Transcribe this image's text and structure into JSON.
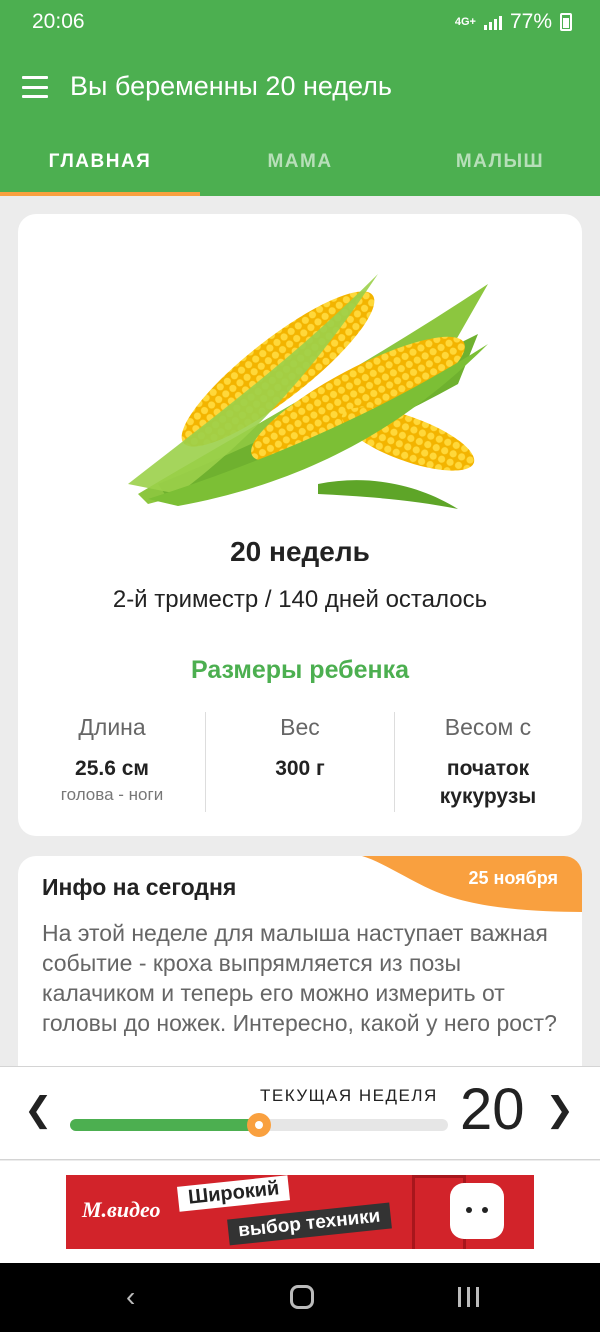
{
  "status": {
    "time": "20:06",
    "network": "4G+",
    "battery": "77%"
  },
  "app": {
    "title": "Вы беременны 20 недель"
  },
  "tabs": [
    {
      "label": "ГЛАВНАЯ",
      "active": true
    },
    {
      "label": "МАМА",
      "active": false
    },
    {
      "label": "МАЛЫШ",
      "active": false
    }
  ],
  "main": {
    "image_icon": "corn-image",
    "week_title": "20 недель",
    "week_subtitle": "2-й триместр / 140 дней осталось",
    "sizes_title": "Размеры ребенка",
    "metrics": [
      {
        "label": "Длина",
        "value": "25.6 см",
        "hint": "голова - ноги"
      },
      {
        "label": "Вес",
        "value": "300 г",
        "hint": ""
      },
      {
        "label": "Весом с",
        "value": "початок кукурузы",
        "hint": ""
      }
    ]
  },
  "info": {
    "title": "Инфо на сегодня",
    "date": "25 ноября",
    "text": "На этой неделе для малыша наступает важная событие - кроха выпрямляется из позы калачиком и теперь его можно измерить от головы до ножек. Интересно, какой у него рост?"
  },
  "week_bar": {
    "label": "ТЕКУЩАЯ НЕДЕЛЯ",
    "number": "20",
    "progress": 0.5,
    "prev_icon": "chevron-left-icon",
    "next_icon": "chevron-right-icon"
  },
  "ad": {
    "brand": "М.видео",
    "line1": "Широкий",
    "line2": "выбор техники"
  },
  "colors": {
    "primary": "#4caf50",
    "accent": "#f9a03f"
  }
}
